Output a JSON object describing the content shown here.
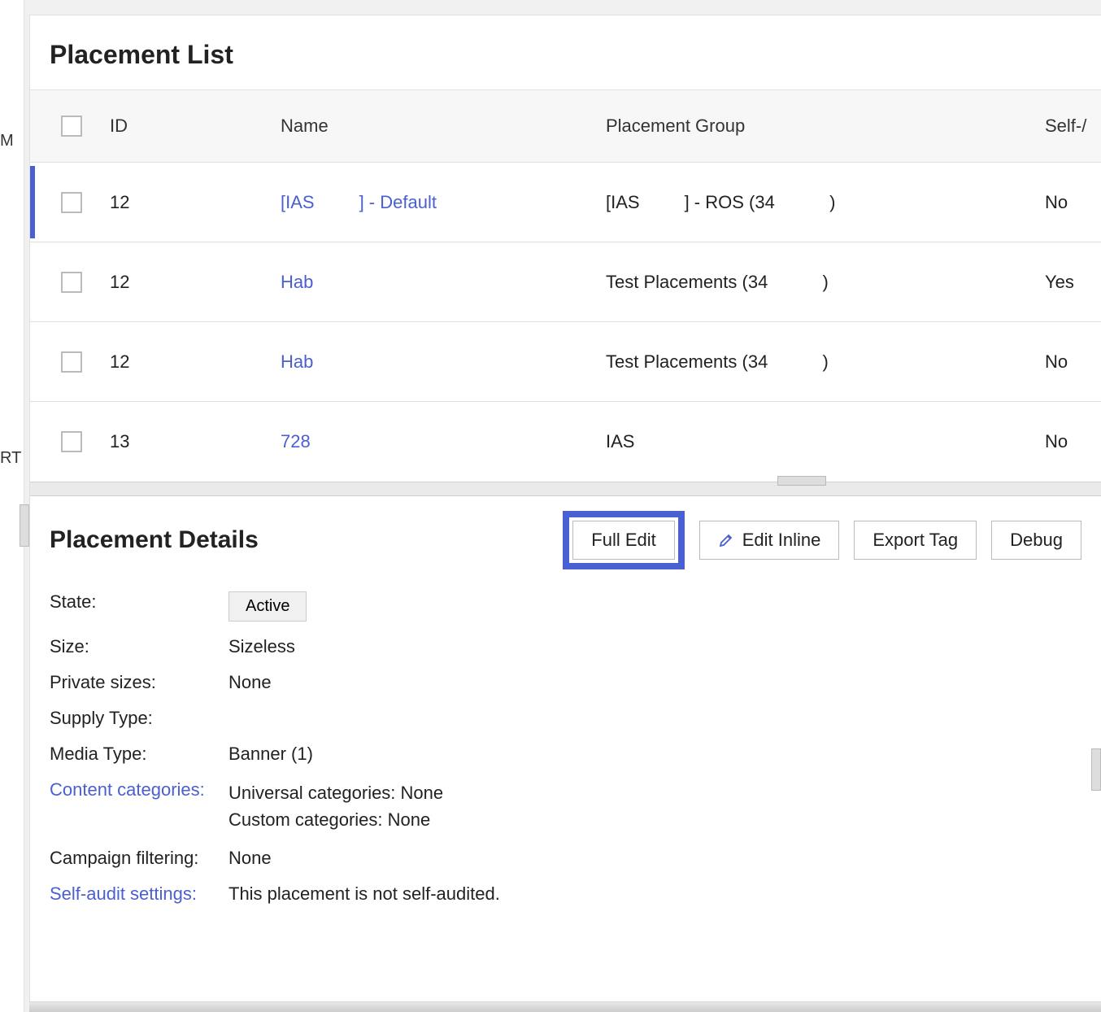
{
  "sidebar_cut": {
    "m": "M",
    "rt": "RT"
  },
  "page_title": "Placement List",
  "table": {
    "headers": {
      "id": "ID",
      "name": "Name",
      "group": "Placement Group",
      "self": "Self-/"
    },
    "rows": [
      {
        "id": "12",
        "name": "[IAS         ] - Default",
        "group": "[IAS         ] - ROS (34           )",
        "self": "No",
        "selected": true
      },
      {
        "id": "12",
        "name": "Hab",
        "group": "Test Placements (34           )",
        "self": "Yes"
      },
      {
        "id": "12",
        "name": "Hab",
        "group": "Test Placements (34           )",
        "self": "No"
      },
      {
        "id": "13",
        "name": "728",
        "group": "IAS",
        "self": "No"
      }
    ]
  },
  "details": {
    "title": "Placement Details",
    "buttons": {
      "full_edit": "Full Edit",
      "edit_inline": "Edit Inline",
      "export_tag": "Export Tag",
      "debug": "Debug"
    },
    "state_label": "State:",
    "state_value": "Active",
    "size_label": "Size:",
    "size_value": "Sizeless",
    "private_sizes_label": "Private sizes:",
    "private_sizes_value": "None",
    "supply_type_label": "Supply Type:",
    "supply_type_value": "",
    "media_type_label": "Media Type:",
    "media_type_value": "Banner (1)",
    "content_categories_label": "Content categories:",
    "content_universal": "Universal categories: None",
    "content_custom": "Custom categories: None",
    "campaign_filtering_label": "Campaign filtering:",
    "campaign_filtering_value": "None",
    "self_audit_label": "Self-audit settings:",
    "self_audit_value": "This placement is not self-audited."
  }
}
